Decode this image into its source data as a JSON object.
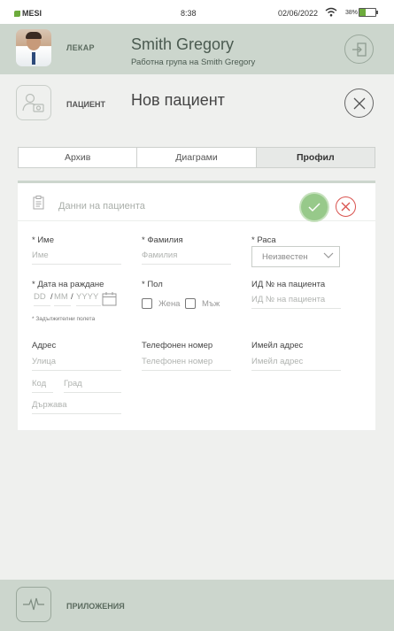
{
  "status_bar": {
    "brand": "MESI",
    "time": "8:38",
    "date": "02/06/2022",
    "battery": "38%"
  },
  "doctor": {
    "role": "ЛЕКАР",
    "name": "Smith Gregory",
    "group": "Работна група на Smith Gregory"
  },
  "patient": {
    "role": "ПАЦИЕНТ",
    "title": "Нов пациент"
  },
  "tabs": [
    {
      "label": "Архив"
    },
    {
      "label": "Диаграми"
    },
    {
      "label": "Профил"
    }
  ],
  "form": {
    "title": "Данни на пациента",
    "first_name": {
      "label": "* Име",
      "placeholder": "Име"
    },
    "last_name": {
      "label": "* Фамилия",
      "placeholder": "Фамилия"
    },
    "race": {
      "label": "* Раса",
      "value": "Неизвестен"
    },
    "dob": {
      "label": "* Дата на раждане",
      "dd": "DD",
      "mm": "MM",
      "yyyy": "YYYY"
    },
    "gender": {
      "label": "* Пол",
      "female": "Жена",
      "male": "Мъж"
    },
    "patient_id": {
      "label": "ИД № на пациента",
      "placeholder": "ИД № на пациента"
    },
    "required_note": "* Задължителни полета",
    "address": {
      "label": "Адрес",
      "street": "Улица",
      "zip": "Код",
      "city": "Град",
      "country": "Държава"
    },
    "phone": {
      "label": "Телефонен номер",
      "placeholder": "Телефонен номер"
    },
    "email": {
      "label": "Имейл адрес",
      "placeholder": "Имейл адрес"
    }
  },
  "bottom": {
    "apps_label": "ПРИЛОЖЕНИЯ"
  },
  "colors": {
    "accent_green": "#97c98a",
    "header_bg": "#ccd6cd",
    "cancel_red": "#d9534f"
  }
}
